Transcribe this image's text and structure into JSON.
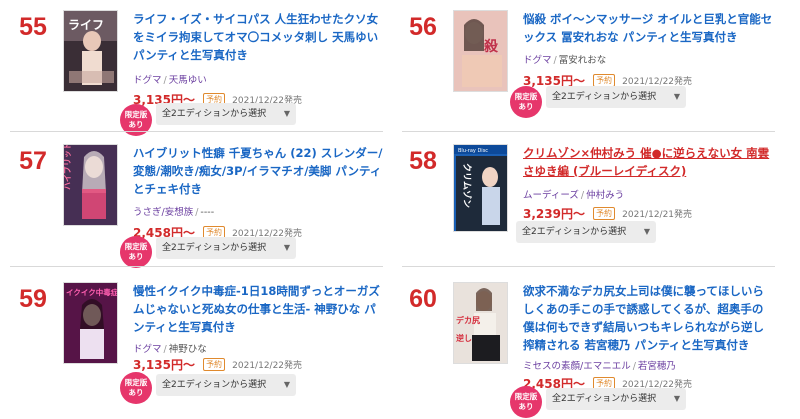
{
  "items": [
    {
      "rank": "55",
      "title": "ライフ・イズ・サイコパス 人生狂わせたクソ女をミイラ拘束してオマ〇コメッタ刺し 天馬ゆい パンティと生写真付き",
      "maker": "ドグマ",
      "actress": "天馬ゆい",
      "price": "3,135円〜",
      "badge": "予約",
      "release": "2021/12/22発売",
      "limited": [
        "限定版",
        "あり"
      ],
      "edition": "全2エディションから選択"
    },
    {
      "rank": "56",
      "title": "悩殺 ボイ〜ンマッサージ オイルと巨乳と官能セックス 冨安れおな パンティと生写真付き",
      "maker": "ドグマ",
      "actress": "冨安れおな",
      "price": "3,135円〜",
      "badge": "予約",
      "release": "2021/12/22発売",
      "limited": [
        "限定版",
        "あり"
      ],
      "edition": "全2エディションから選択"
    },
    {
      "rank": "57",
      "title": "ハイブリット性癖 千夏ちゃん (22) スレンダー/変態/潮吹き/痴女/3P/イラマチオ/美脚 パンティとチェキ付き",
      "maker": "うさぎ/妄想族",
      "actress": "----",
      "price": "2,458円〜",
      "badge": "予約",
      "release": "2021/12/22発売",
      "limited": [
        "限定版",
        "あり"
      ],
      "edition": "全2エディションから選択"
    },
    {
      "rank": "58",
      "title": "クリムゾン×仲村みう 催●に逆らえない女 南雲さゆき編 (ブルーレイディスク)",
      "maker": "ムーディーズ",
      "actress": "仲村みう",
      "price": "3,239円〜",
      "badge": "予約",
      "release": "2021/12/21発売",
      "edition": "全2エディションから選択"
    },
    {
      "rank": "59",
      "title": "慢性イクイク中毒症-1日18時間ずっとオーガズムじゃないと死ぬ女の仕事と生活- 神野ひな パンティと生写真付き",
      "maker": "ドグマ",
      "actress": "神野ひな",
      "price": "3,135円〜",
      "badge": "予約",
      "release": "2021/12/22発売",
      "limited": [
        "限定版",
        "あり"
      ],
      "edition": "全2エディションから選択"
    },
    {
      "rank": "60",
      "title": "欲求不満なデカ尻女上司は僕に襲ってほしいらしくあの手この手で誘惑してくるが、超奥手の僕は何もできず結局いつもキレられながら逆し搾精される 若宮穂乃 パンティと生写真付き",
      "maker": "ミセスの素顔/エマニエル",
      "actress": "若宮穂乃",
      "price": "2,458円〜",
      "badge": "予約",
      "release": "2021/12/22発売",
      "limited": [
        "限定版",
        "あり"
      ],
      "edition": "全2エディションから選択"
    }
  ],
  "colors": {
    "rank": "#d22a2a",
    "title_link": "#1a67c4",
    "maker_link": "#6b3fa0",
    "price": "#d22a2a",
    "limited_badge": "#e6366b",
    "reserve_badge": "#e08a2e"
  }
}
